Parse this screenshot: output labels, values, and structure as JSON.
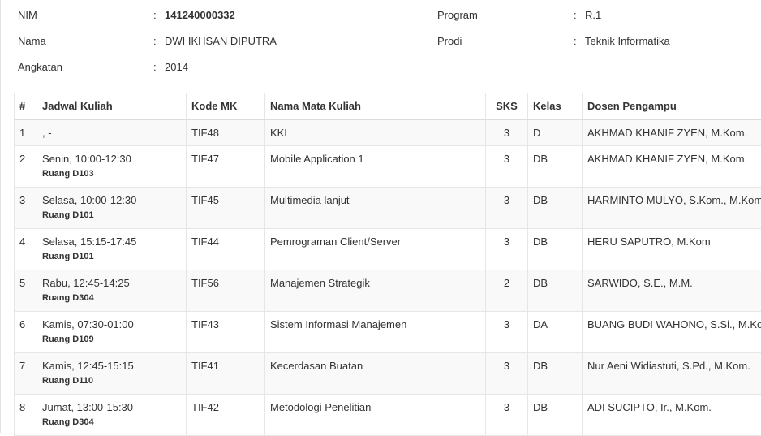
{
  "student": {
    "nim_label": "NIM",
    "nim": "141240000332",
    "nama_label": "Nama",
    "nama": "DWI IKHSAN DIPUTRA",
    "angkatan_label": "Angkatan",
    "angkatan": "2014",
    "program_label": "Program",
    "program": "R.1",
    "prodi_label": "Prodi",
    "prodi": "Teknik Informatika",
    "separator": ":"
  },
  "table": {
    "headers": [
      "#",
      "Jadwal Kuliah",
      "Kode MK",
      "Nama Mata Kuliah",
      "SKS",
      "Kelas",
      "Dosen Pengampu"
    ],
    "rows": [
      {
        "no": "1",
        "jadwal": ", -",
        "ruang": "",
        "kode": "TIF48",
        "nama": "KKL",
        "sks": "3",
        "kelas": "D",
        "dosen": "AKHMAD KHANIF ZYEN, M.Kom."
      },
      {
        "no": "2",
        "jadwal": "Senin, 10:00-12:30",
        "ruang": "Ruang D103",
        "kode": "TIF47",
        "nama": "Mobile Application 1",
        "sks": "3",
        "kelas": "DB",
        "dosen": "AKHMAD KHANIF ZYEN, M.Kom."
      },
      {
        "no": "3",
        "jadwal": "Selasa, 10:00-12:30",
        "ruang": "Ruang D101",
        "kode": "TIF45",
        "nama": "Multimedia lanjut",
        "sks": "3",
        "kelas": "DB",
        "dosen": "HARMINTO MULYO, S.Kom., M.Kom."
      },
      {
        "no": "4",
        "jadwal": "Selasa, 15:15-17:45",
        "ruang": "Ruang D101",
        "kode": "TIF44",
        "nama": "Pemrograman Client/Server",
        "sks": "3",
        "kelas": "DB",
        "dosen": "HERU SAPUTRO, M.Kom"
      },
      {
        "no": "5",
        "jadwal": "Rabu, 12:45-14:25",
        "ruang": "Ruang D304",
        "kode": "TIF56",
        "nama": "Manajemen Strategik",
        "sks": "2",
        "kelas": "DB",
        "dosen": "SARWIDO, S.E., M.M."
      },
      {
        "no": "6",
        "jadwal": "Kamis, 07:30-01:00",
        "ruang": "Ruang D109",
        "kode": "TIF43",
        "nama": "Sistem Informasi Manajemen",
        "sks": "3",
        "kelas": "DA",
        "dosen": "BUANG BUDI WAHONO, S.Si., M.Kom"
      },
      {
        "no": "7",
        "jadwal": "Kamis, 12:45-15:15",
        "ruang": "Ruang D110",
        "kode": "TIF41",
        "nama": "Kecerdasan Buatan",
        "sks": "3",
        "kelas": "DB",
        "dosen": "Nur Aeni Widiastuti, S.Pd., M.Kom."
      },
      {
        "no": "8",
        "jadwal": "Jumat, 13:00-15:30",
        "ruang": "Ruang D304",
        "kode": "TIF42",
        "nama": "Metodologi Penelitian",
        "sks": "3",
        "kelas": "DB",
        "dosen": "ADI SUCIPTO, Ir., M.Kom."
      }
    ]
  }
}
